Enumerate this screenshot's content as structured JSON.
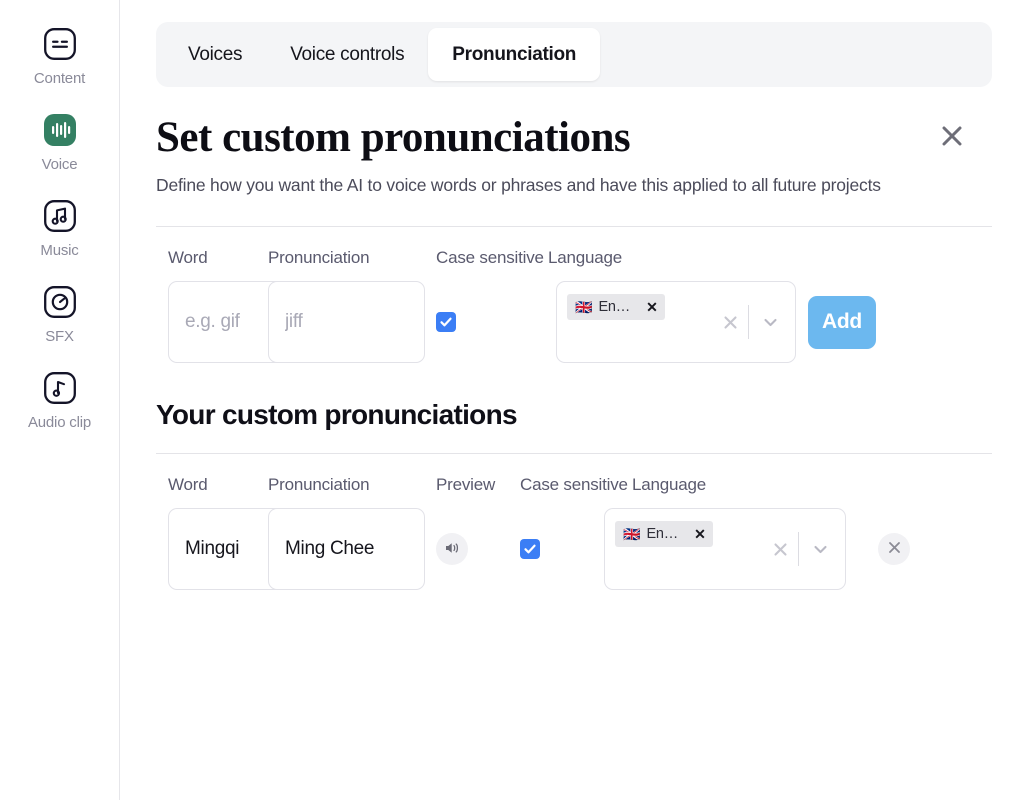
{
  "sidebar": {
    "items": [
      {
        "label": "Content",
        "icon": "content-icon",
        "active": false
      },
      {
        "label": "Voice",
        "icon": "voice-icon",
        "active": true
      },
      {
        "label": "Music",
        "icon": "music-icon",
        "active": false
      },
      {
        "label": "SFX",
        "icon": "sfx-icon",
        "active": false
      },
      {
        "label": "Audio clip",
        "icon": "audio-clip-icon",
        "active": false
      }
    ]
  },
  "tabs": [
    {
      "label": "Voices",
      "active": false
    },
    {
      "label": "Voice controls",
      "active": false
    },
    {
      "label": "Pronunciation",
      "active": true
    }
  ],
  "header": {
    "title": "Set custom pronunciations",
    "description": "Define how you want the AI to voice words or phrases and have this applied to all future projects",
    "close_icon": "close-icon"
  },
  "add_form": {
    "columns": [
      "Word",
      "Pronunciation",
      "Case sensitive",
      "Language"
    ],
    "word": {
      "value": "",
      "placeholder": "e.g. gif"
    },
    "pronunciation": {
      "value": "",
      "placeholder": "jiff"
    },
    "case_sensitive": true,
    "language": {
      "chips": [
        {
          "flag": "🇬🇧",
          "label": "En…"
        }
      ],
      "clear_icon": "clear-icon",
      "dropdown_icon": "chevron-down-icon"
    },
    "add_label": "Add"
  },
  "list": {
    "title": "Your custom pronunciations",
    "columns": [
      "Word",
      "Pronunciation",
      "Preview",
      "Case sensitive",
      "Language"
    ],
    "rows": [
      {
        "word": "Mingqi",
        "pronunciation": "Ming Chee",
        "preview_icon": "speaker-icon",
        "case_sensitive": true,
        "language": {
          "chips": [
            {
              "flag": "🇬🇧",
              "label": "En…"
            }
          ],
          "clear_icon": "clear-icon",
          "dropdown_icon": "chevron-down-icon"
        },
        "remove_icon": "remove-icon"
      }
    ]
  },
  "colors": {
    "accent_green": "#348063",
    "add_button": "#6cb8ef",
    "checkbox": "#3b7ef5",
    "tabbar_bg": "#f4f5f7",
    "text_muted": "#5a5a6e"
  }
}
